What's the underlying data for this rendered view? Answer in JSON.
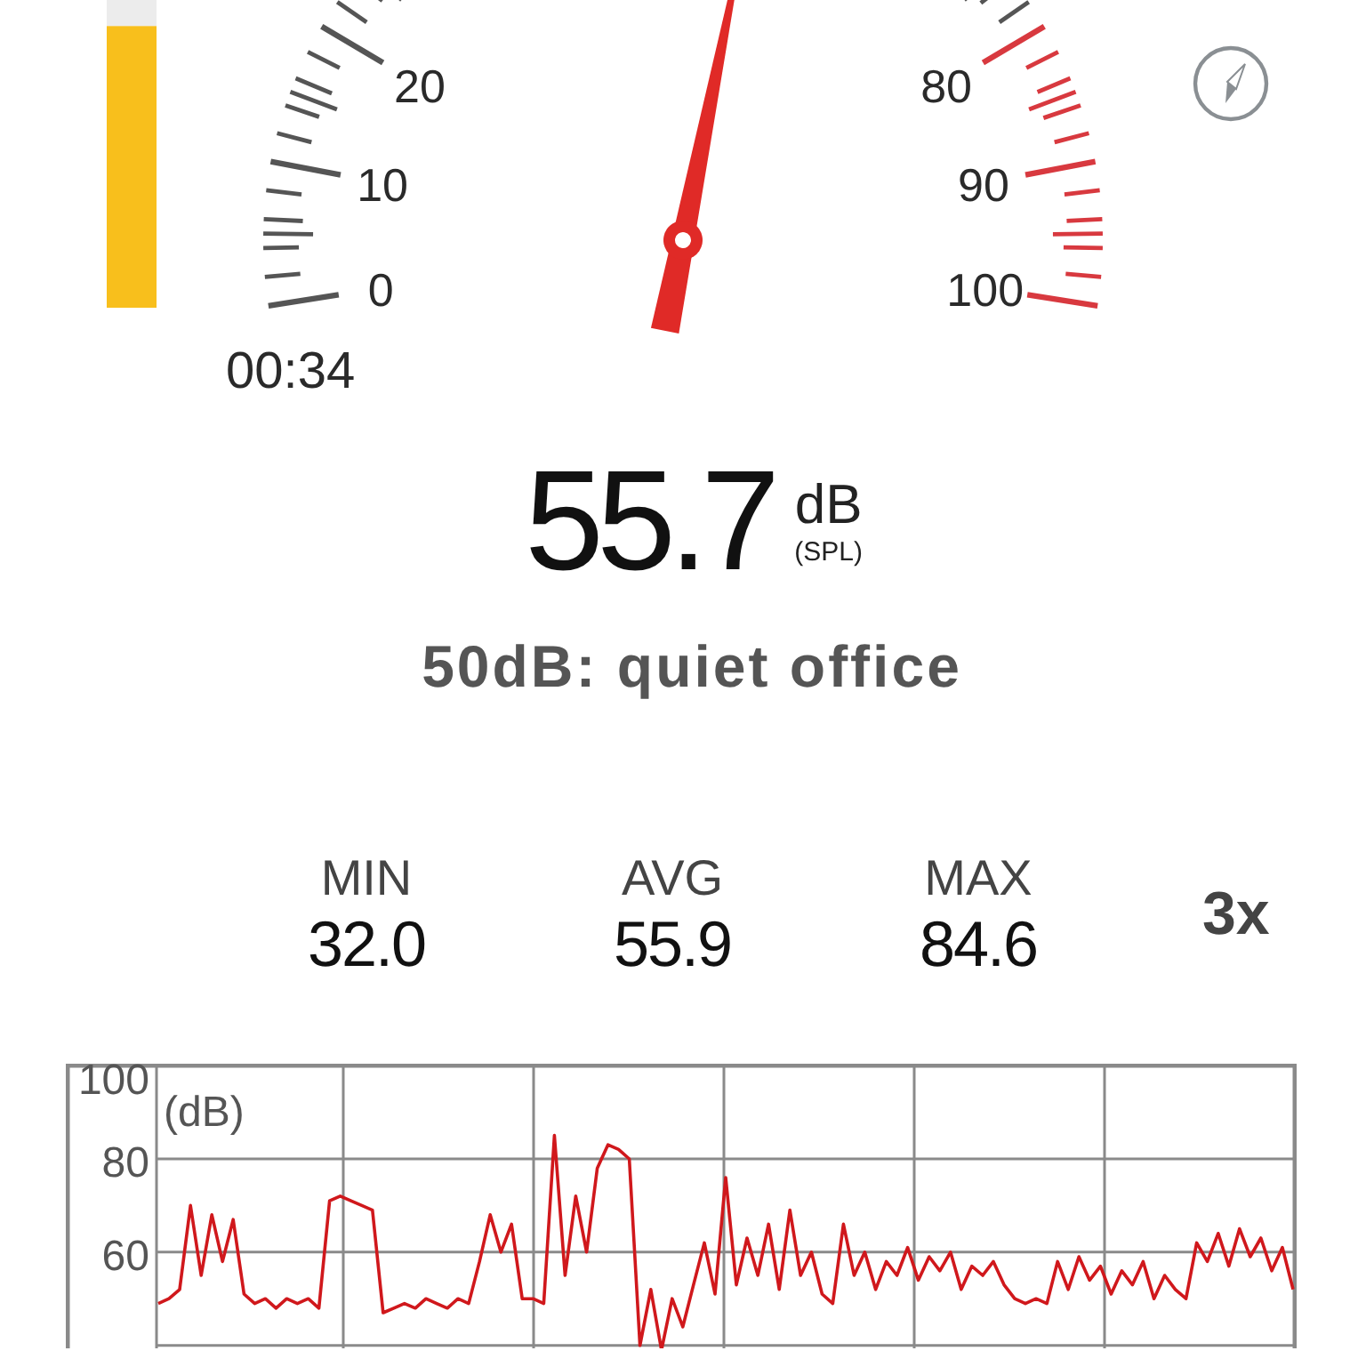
{
  "meter": {
    "level": 0.78
  },
  "gauge": {
    "scale_labels": [
      "20",
      "80",
      "10",
      "90",
      "0",
      "100"
    ],
    "needle": {
      "level": 0.557
    }
  },
  "time": "00:34",
  "reading": {
    "value": "55.7",
    "unit": "dB",
    "weighting": "(SPL)"
  },
  "reference": "50dB: quiet office",
  "stats": [
    {
      "label": "MIN",
      "value": "32.0"
    },
    {
      "label": "AVG",
      "value": "55.9"
    },
    {
      "label": "MAX",
      "value": "84.6"
    }
  ],
  "speed": "3x",
  "chart": {
    "chart_data": {
      "type": "line",
      "ylabel": "(dB)",
      "ylim": [
        39,
        100
      ],
      "grid": true,
      "yticks": [
        60,
        80,
        100
      ],
      "series": [
        {
          "color": "#d0181c",
          "values": [
            49,
            50,
            52,
            70,
            55,
            68,
            58,
            67,
            51,
            49,
            50,
            48,
            50,
            49,
            50,
            48,
            71,
            72,
            71,
            70,
            69,
            47,
            48,
            49,
            48,
            50,
            49,
            48,
            50,
            49,
            58,
            68,
            60,
            66,
            50,
            50,
            49,
            85,
            55,
            72,
            60,
            78,
            83,
            82,
            80,
            40,
            52,
            39,
            50,
            44,
            53,
            62,
            51,
            76,
            53,
            63,
            55,
            66,
            52,
            69,
            55,
            60,
            51,
            49,
            66,
            55,
            60,
            52,
            58,
            55,
            61,
            54,
            59,
            56,
            60,
            52,
            57,
            55,
            58,
            53,
            50,
            49,
            50,
            49,
            58,
            52,
            59,
            54,
            57,
            51,
            56,
            53,
            58,
            50,
            55,
            52,
            50,
            62,
            58,
            64,
            57,
            65,
            59,
            63,
            56,
            61,
            52
          ]
        }
      ]
    }
  }
}
